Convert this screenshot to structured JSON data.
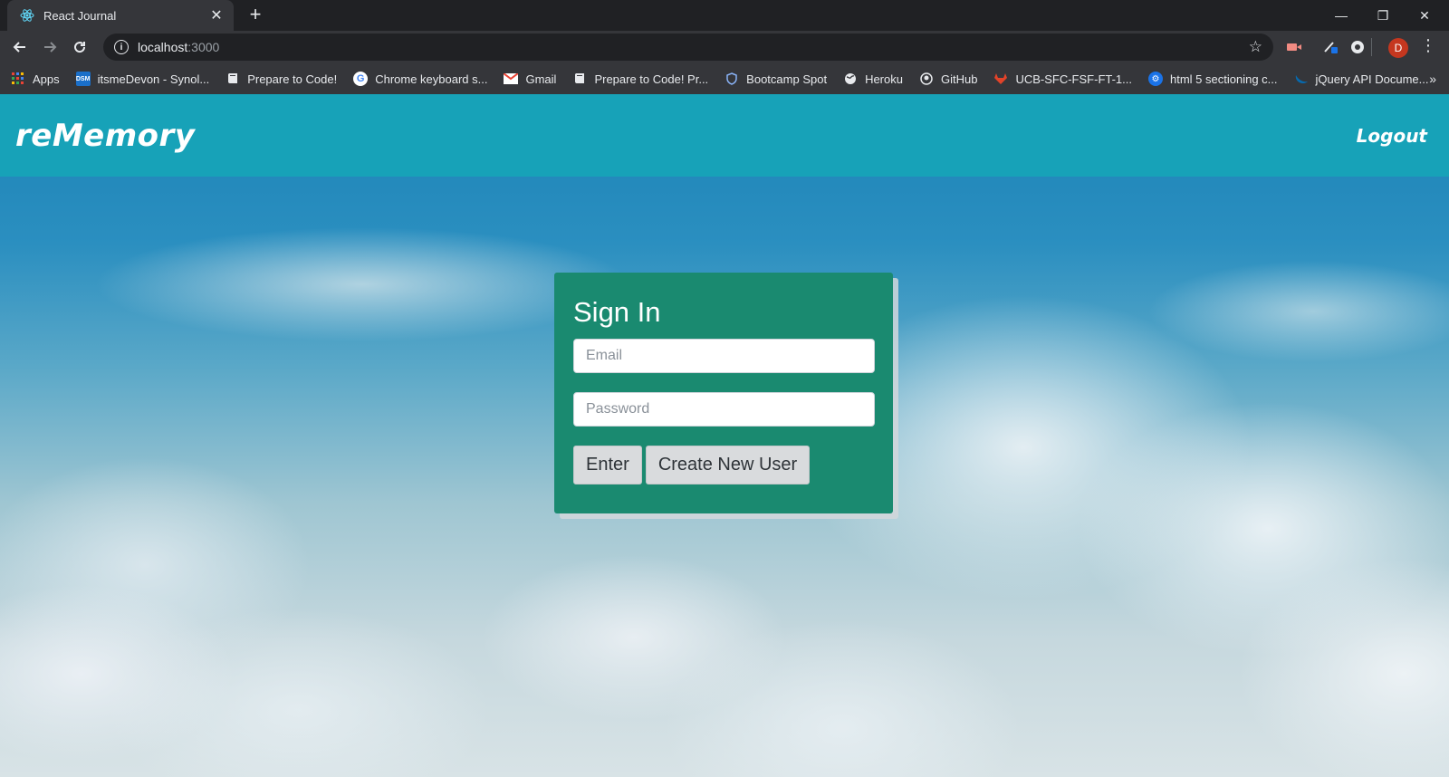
{
  "browser": {
    "tab_title": "React Journal",
    "tab_close": "✕",
    "new_tab": "+",
    "window_controls": {
      "minimize": "—",
      "restore": "❐",
      "close": "✕"
    },
    "url_host": "localhost",
    "url_port": ":3000",
    "avatar_initial": "D",
    "bookmarks_overflow": "»",
    "bookmarks": [
      {
        "label": "Apps",
        "icon": "apps-grid-icon"
      },
      {
        "label": "itsmeDevon - Synol...",
        "icon": "dsm-icon"
      },
      {
        "label": "Prepare to Code!",
        "icon": "book-icon"
      },
      {
        "label": "Chrome keyboard s...",
        "icon": "google-icon"
      },
      {
        "label": "Gmail",
        "icon": "gmail-icon"
      },
      {
        "label": "Prepare to Code! Pr...",
        "icon": "book-icon"
      },
      {
        "label": "Bootcamp Spot",
        "icon": "shield-icon"
      },
      {
        "label": "Heroku",
        "icon": "globe-icon"
      },
      {
        "label": "GitHub",
        "icon": "github-icon"
      },
      {
        "label": "UCB-SFC-FSF-FT-1...",
        "icon": "gitlab-icon"
      },
      {
        "label": "html 5 sectioning c...",
        "icon": "settings-icon"
      },
      {
        "label": "jQuery API Docume...",
        "icon": "jquery-icon"
      }
    ]
  },
  "app": {
    "brand": "reMemory",
    "logout_label": "Logout",
    "header_color": "#17a2b8"
  },
  "signin": {
    "title": "Sign In",
    "email_placeholder": "Email",
    "password_placeholder": "Password",
    "enter_label": "Enter",
    "create_label": "Create New User",
    "card_color": "#1a8a70"
  }
}
